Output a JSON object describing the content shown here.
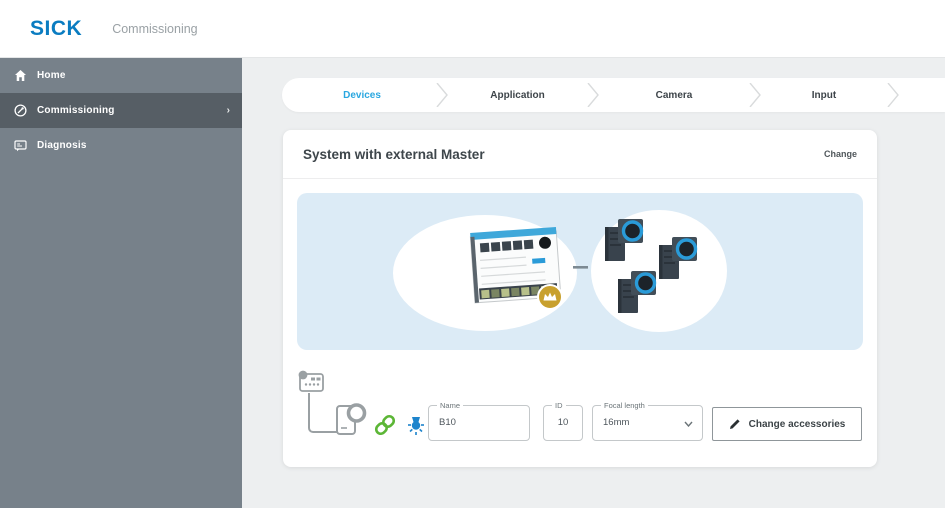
{
  "header": {
    "logo": "SICK",
    "app_title": "Commissioning"
  },
  "sidebar": {
    "items": [
      {
        "label": "Home",
        "icon": "home-icon",
        "selected": false
      },
      {
        "label": "Commissioning",
        "icon": "commissioning-icon",
        "selected": true,
        "chevron": "›"
      },
      {
        "label": "Diagnosis",
        "icon": "diagnosis-icon",
        "selected": false
      }
    ]
  },
  "breadcrumb": {
    "steps": [
      {
        "label": "Devices",
        "active": true
      },
      {
        "label": "Application",
        "active": false
      },
      {
        "label": "Camera",
        "active": false
      },
      {
        "label": "Input",
        "active": false
      }
    ]
  },
  "card": {
    "title": "System with external Master",
    "change_link": "Change",
    "illustration": {
      "left_device": "master-controller",
      "right_devices": "three-cameras",
      "badge": "crown-badge"
    },
    "form": {
      "name_field": {
        "label": "Name",
        "value": "B10"
      },
      "id_field": {
        "label": "ID",
        "value": "10"
      },
      "focal_length_field": {
        "label": "Focal length",
        "value": "16mm"
      },
      "change_accessories_button": "Change accessories"
    }
  },
  "colors": {
    "sick_blue": "#0a7cc1",
    "active_step_blue": "#2aa7e0",
    "sidebar_bg": "#77818a",
    "sidebar_selected": "#565e65",
    "content_bg": "#edeff0",
    "panel_blue": "#dcebf6",
    "crown_gold": "#c8a02e",
    "link_green": "#5cb636",
    "lamp_blue": "#1d84cc",
    "camera_lens_blue": "#2a9bd8"
  }
}
